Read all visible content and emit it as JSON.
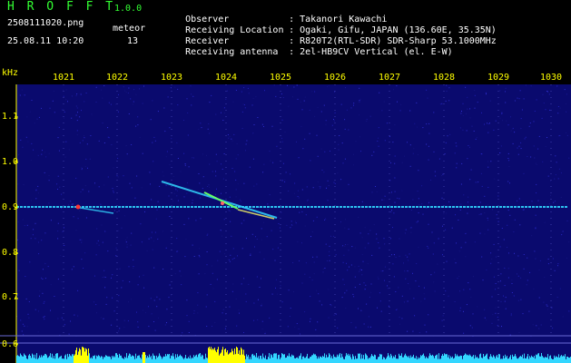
{
  "header": {
    "app_title": "H R O F F T",
    "version": "1.0.0",
    "filename": "2508111020.png",
    "datetime": "25.08.11 10:20",
    "meteor_label": "meteor",
    "meteor_count": "13"
  },
  "info": [
    {
      "label": "Observer",
      "value": "Takanori Kawachi"
    },
    {
      "label": "Receiving Location",
      "value": "Ogaki, Gifu, JAPAN (136.60E, 35.35N)"
    },
    {
      "label": "Receiver",
      "value": "R820T2(RTL-SDR) SDR-Sharp 53.1000MHz"
    },
    {
      "label": "Receiving antenna",
      "value": "2el-HB9CV Vertical (el. E-W)"
    }
  ],
  "info_separator": ":",
  "spectrogram": {
    "y_unit": "kHz",
    "y_ticks": [
      "1.1",
      "1.0",
      "0.9",
      "0.8",
      "0.7",
      "0.6"
    ],
    "x_ticks": [
      "1021",
      "1022",
      "1023",
      "1024",
      "1025",
      "1026",
      "1027",
      "1028",
      "1029",
      "1030"
    ]
  },
  "colors": {
    "background": "#000000",
    "plot_background": "#0a0a6e",
    "title_green": "#33ff33",
    "axis_yellow": "#ffff00",
    "text_white": "#ffffff",
    "carrier_cyan": "#33d6ff",
    "echo_green": "#66ff66",
    "echo_red": "#ff3333",
    "bar_yellow": "#ffff00",
    "bar_cyan": "#33d6ff"
  }
}
